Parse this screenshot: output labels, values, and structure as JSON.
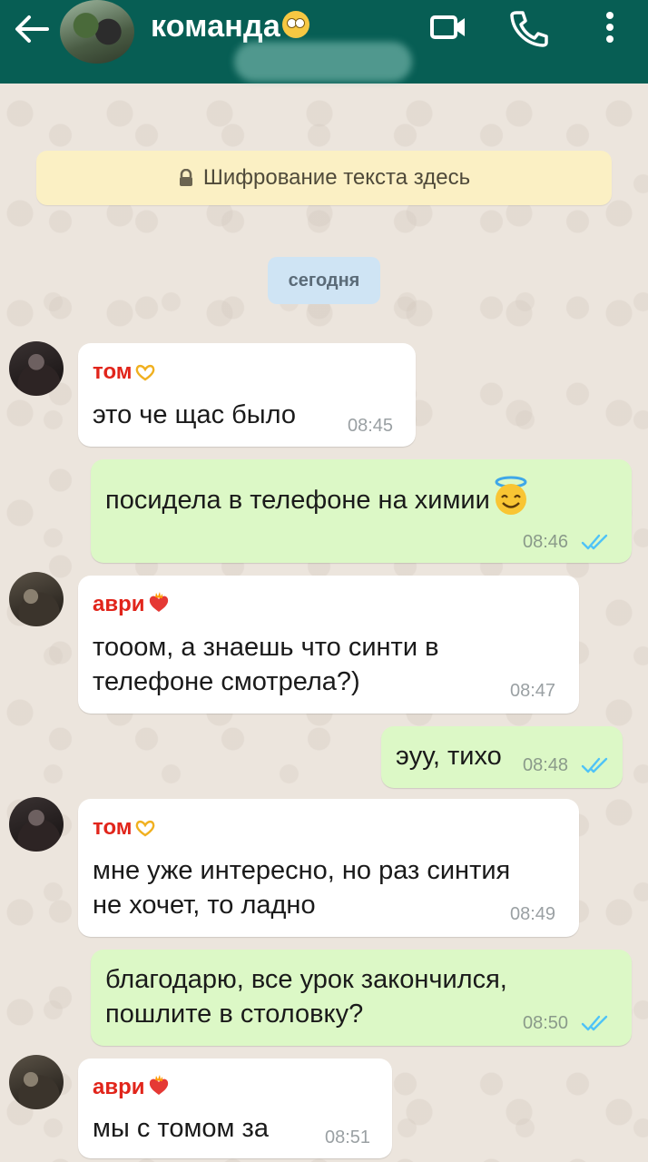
{
  "header": {
    "title": "команда",
    "title_emoji": "eye-roll-emoji",
    "icons": [
      "back-arrow-icon",
      "video-call-icon",
      "phone-icon",
      "more-vert-icon"
    ],
    "bar_color": "#075e54"
  },
  "encryption_notice": {
    "text": "Шифрование текста здесь",
    "icon": "lock-icon"
  },
  "date_chip": "сегодня",
  "messages": [
    {
      "direction": "in",
      "sender": "том",
      "sender_emoji": "heart-hands-emoji",
      "text": "это че щас было",
      "time": "08:45"
    },
    {
      "direction": "out",
      "text": "посидела в телефоне на химии",
      "emoji": "smiling-face-with-halo-emoji",
      "time": "08:46",
      "status": "read"
    },
    {
      "direction": "in",
      "sender": "аври",
      "sender_emoji": "heart-on-fire-emoji",
      "text": "тооом, а знаешь что синти в\nтелефоне смотрела?)",
      "time": "08:47"
    },
    {
      "direction": "out",
      "text": "эуу, тихо",
      "time": "08:48",
      "status": "read"
    },
    {
      "direction": "in",
      "sender": "том",
      "sender_emoji": "heart-hands-emoji",
      "text": "мне уже интересно, но раз синтия\nне хочет, то ладно",
      "time": "08:49"
    },
    {
      "direction": "out",
      "text": "благодарю, все урок закончился,\nпошлите в столовку?",
      "time": "08:50",
      "status": "read"
    },
    {
      "direction": "in",
      "sender": "аври",
      "sender_emoji": "heart-on-fire-emoji",
      "text": "мы с томом за",
      "time": "08:51"
    }
  ],
  "colors": {
    "incoming_bubble": "#ffffff",
    "outgoing_bubble": "#dcf8c6",
    "read_ticks": "#4fc3f7",
    "sender_name": "#e1251b"
  }
}
